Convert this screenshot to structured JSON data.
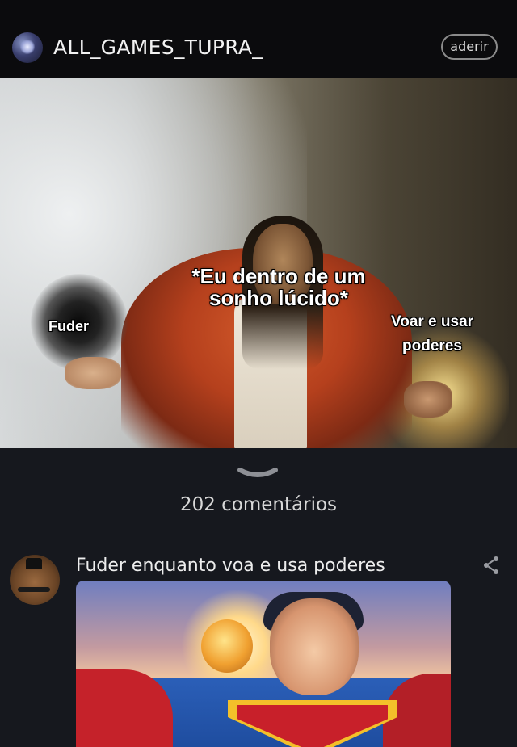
{
  "header": {
    "username": "ALL_GAMES_TUPRA_",
    "join_label": "aderir"
  },
  "post": {
    "caption_main": "*Eu dentro de um sonho lúcido*",
    "caption_left": "Fuder",
    "caption_right": "Voar e usar poderes",
    "comments_count": "202 comentários"
  },
  "comment": {
    "text": "Fuder enquanto voa e usa poderes",
    "share_icon": "share-icon"
  }
}
